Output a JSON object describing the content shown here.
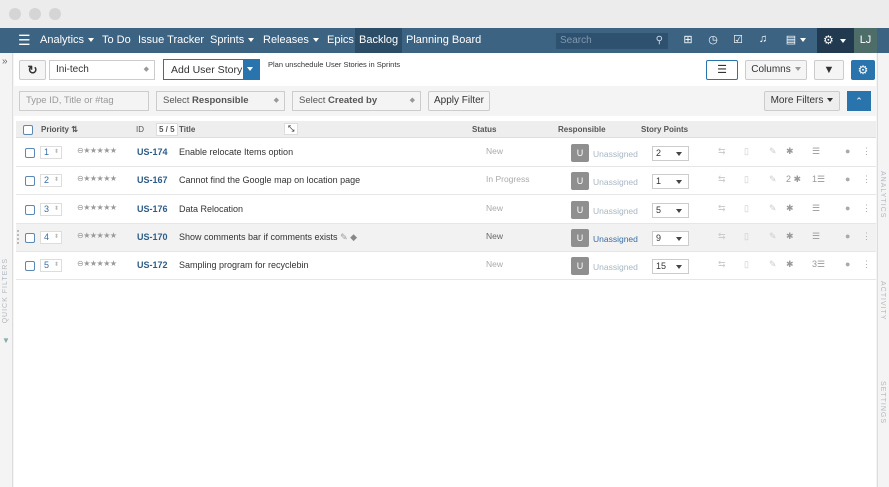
{
  "nav": {
    "items": [
      {
        "label": "Analytics",
        "caret": true
      },
      {
        "label": "To Do"
      },
      {
        "label": "Issue Tracker"
      },
      {
        "label": "Sprints",
        "caret": true
      },
      {
        "label": "Releases",
        "caret": true
      },
      {
        "label": "Epics"
      },
      {
        "label": "Backlog",
        "active": true
      },
      {
        "label": "Planning Board"
      }
    ],
    "search_placeholder": "Search",
    "user_initials": "LJ"
  },
  "sidebar": {
    "quick_filters": "QUICK FILTERS",
    "analytics": "ANALYTICS",
    "activity": "ACTIVITY",
    "settings": "SETTINGS"
  },
  "toolbar": {
    "project": "Ini-tech",
    "add_story": "Add User Story",
    "plan_text": "Plan unschedule User Stories in Sprints",
    "columns": "Columns"
  },
  "filters": {
    "search_placeholder": "Type ID, Title or #tag",
    "responsible_prefix": "Select ",
    "responsible": "Responsible",
    "created_prefix": "Select ",
    "created": "Created by",
    "apply": "Apply Filter",
    "more": "More Filters"
  },
  "table": {
    "headers": {
      "priority": "Priority",
      "id": "ID",
      "count": "5 / 5",
      "title": "Title",
      "status": "Status",
      "responsible": "Responsible",
      "story_points": "Story Points"
    },
    "rows": [
      {
        "priority": "1",
        "id": "US-174",
        "title": "Enable relocate Items option",
        "status": "New",
        "avatar": "U",
        "responsible": "Unassigned",
        "points": "2",
        "bugs": "",
        "tasks": ""
      },
      {
        "priority": "2",
        "id": "US-167",
        "title": "Cannot find the Google map on location page",
        "status": "In Progress",
        "avatar": "U",
        "responsible": "Unassigned",
        "points": "1",
        "bugs": "2",
        "tasks": "1"
      },
      {
        "priority": "3",
        "id": "US-176",
        "title": "Data Relocation",
        "status": "New",
        "avatar": "U",
        "responsible": "Unassigned",
        "points": "5",
        "bugs": "",
        "tasks": ""
      },
      {
        "priority": "4",
        "id": "US-170",
        "title": "Show comments bar if comments exists",
        "status": "New",
        "avatar": "U",
        "responsible": "Unassigned",
        "points": "9",
        "bugs": "",
        "tasks": "",
        "hover": true
      },
      {
        "priority": "5",
        "id": "US-172",
        "title": "Sampling program for recyclebin",
        "status": "New",
        "avatar": "U",
        "responsible": "Unassigned",
        "points": "15",
        "bugs": "",
        "tasks": "3"
      }
    ]
  },
  "colors": {
    "nav": "#3c6382",
    "accent": "#2a74ad"
  }
}
